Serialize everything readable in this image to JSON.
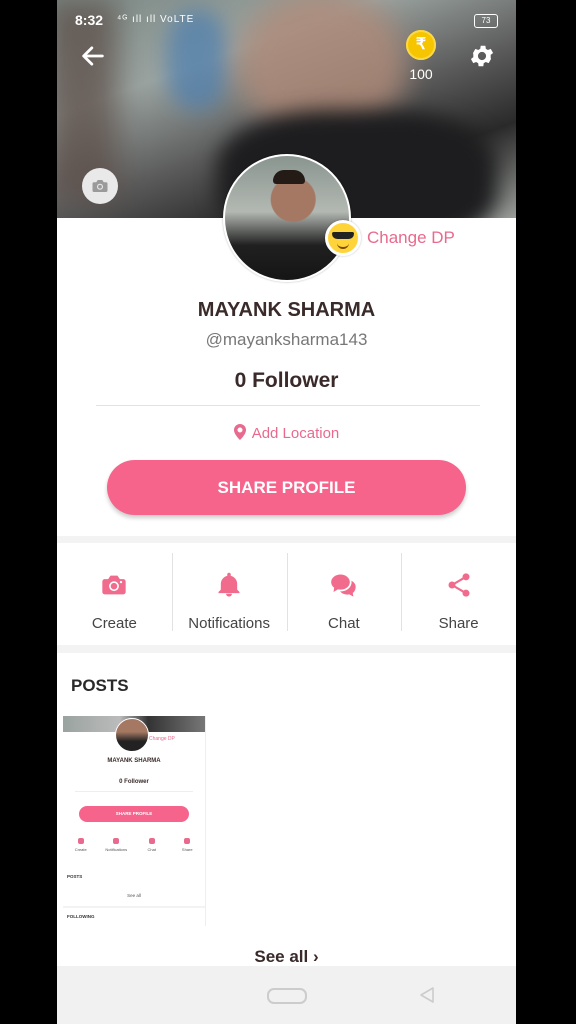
{
  "status_bar": {
    "time": "8:32",
    "signal": "⁴ᴳ ıll ıll VoLTE",
    "battery": "73"
  },
  "header": {
    "coins": "100",
    "coin_symbol": "₹"
  },
  "profile": {
    "change_dp_label": "Change DP",
    "name": "MAYANK SHARMA",
    "handle": "@mayanksharma143",
    "followers": "0 Follower",
    "location": "Add Location",
    "share_button": "SHARE PROFILE"
  },
  "actions": [
    {
      "label": "Create",
      "icon": "camera-icon"
    },
    {
      "label": "Notifications",
      "icon": "bell-icon"
    },
    {
      "label": "Chat",
      "icon": "chat-icon"
    },
    {
      "label": "Share",
      "icon": "share-icon"
    }
  ],
  "posts": {
    "title": "POSTS",
    "see_all": "See all",
    "thumbnail": {
      "change_dp": "Change DP",
      "name": "MAYANK SHARMA",
      "followers": "0 Follower",
      "share": "SHARE PROFILE",
      "actions": [
        "Create",
        "Notifications",
        "Chat",
        "Share"
      ],
      "posts": "POSTS",
      "see_all": "See all",
      "following": "FOLLOWING"
    }
  },
  "colors": {
    "accent": "#f6648c",
    "accent_text": "#e86a8e",
    "coin": "#f6c500"
  }
}
